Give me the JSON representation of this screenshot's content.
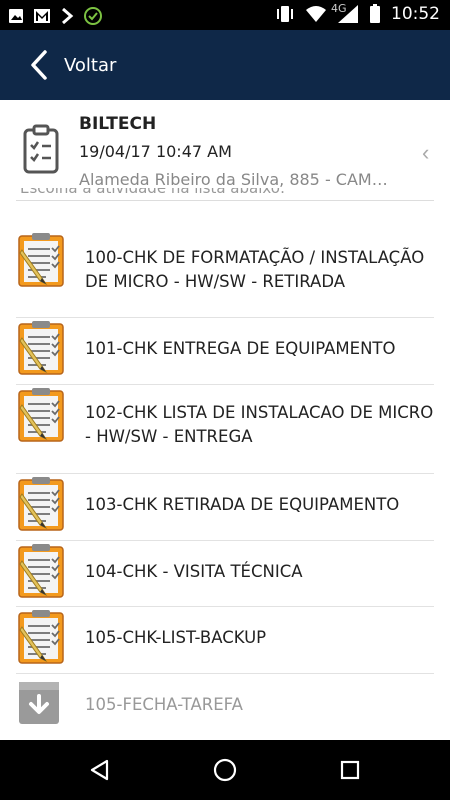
{
  "status_bar": {
    "time": "10:52",
    "network": "4G",
    "left_icons": [
      "image-icon",
      "gmail-icon",
      "chevron-right-icon",
      "check-circle-icon"
    ],
    "right_icons": [
      "vibrate-icon",
      "wifi-icon",
      "cell-signal-icon",
      "battery-icon"
    ]
  },
  "app_bar": {
    "back_label": "Voltar",
    "background": "#0f2848"
  },
  "task": {
    "company": "BILTECH",
    "datetime": "19/04/17 10:47 AM",
    "address": "Alameda Ribeiro da Silva, 885 - CAM…",
    "partial_text": "Escolha a atividade na lista abaixo:"
  },
  "checklist": [
    {
      "label": "100-CHK DE FORMATAÇÃO / INSTALAÇÃO DE MICRO - HW/SW - RETIRADA",
      "icon": "checklist-icon"
    },
    {
      "label": "101-CHK ENTREGA DE EQUIPAMENTO",
      "icon": "checklist-icon"
    },
    {
      "label": "102-CHK LISTA DE INSTALACAO DE MICRO - HW/SW - ENTREGA",
      "icon": "checklist-icon"
    },
    {
      "label": "103-CHK RETIRADA DE EQUIPAMENTO",
      "icon": "checklist-icon"
    },
    {
      "label": "104-CHK - VISITA TÉCNICA",
      "icon": "checklist-icon"
    },
    {
      "label": "105-CHK-LIST-BACKUP",
      "icon": "checklist-icon"
    },
    {
      "label": "105-FECHA-TAREFA",
      "icon": "archive-download-icon"
    }
  ],
  "nav_bar": {
    "buttons": [
      "back-triangle-icon",
      "home-circle-icon",
      "recents-square-icon"
    ]
  }
}
